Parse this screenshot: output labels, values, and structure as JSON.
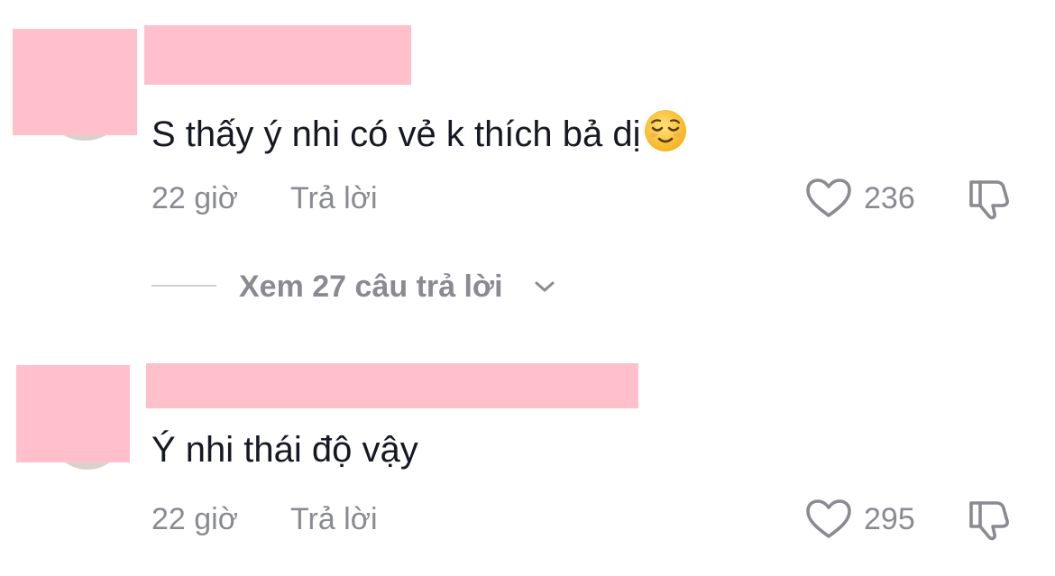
{
  "theme": {
    "mask_color": "#ffc0cb",
    "text_color": "#161823",
    "secondary_color": "#8a8b91"
  },
  "comments": [
    {
      "text": "S thấy ý nhi có vẻ k thích bả dị",
      "emoji": "relieved-face-emoji",
      "time": "22 giờ",
      "reply_label": "Trả lời",
      "likes": "236"
    },
    {
      "text": "Ý nhi thái độ vậy",
      "time": "22 giờ",
      "reply_label": "Trả lời",
      "likes": "295"
    }
  ],
  "view_replies": {
    "label": "Xem 27 câu trả lời",
    "icon": "chevron-down-icon"
  }
}
